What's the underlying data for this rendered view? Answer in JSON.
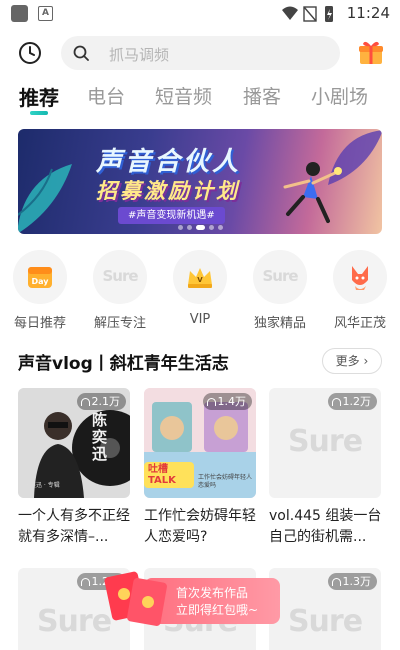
{
  "status_bar": {
    "time": "11:24",
    "app_icon_letter": "A"
  },
  "search": {
    "placeholder": "抓马调频"
  },
  "tabs": [
    {
      "label": "推荐",
      "active": true
    },
    {
      "label": "电台",
      "active": false
    },
    {
      "label": "短音频",
      "active": false
    },
    {
      "label": "播客",
      "active": false
    },
    {
      "label": "小剧场",
      "active": false
    }
  ],
  "banner": {
    "title_line1": "声音合伙人",
    "title_line2": "招募激励计划",
    "tagline": "#声音变现新机遇#",
    "slide_count": 5,
    "active_slide": 2
  },
  "quick_entries": [
    {
      "label": "每日推荐",
      "icon": "calendar-day-icon",
      "icon_text": "Day"
    },
    {
      "label": "解压专注",
      "icon": "sure-logo-icon",
      "icon_text": "Sure"
    },
    {
      "label": "VIP",
      "icon": "vip-crown-icon",
      "icon_text": "V"
    },
    {
      "label": "独家精品",
      "icon": "sure-logo-icon",
      "icon_text": "Sure"
    },
    {
      "label": "风华正茂",
      "icon": "fox-mascot-icon",
      "icon_text": ""
    }
  ],
  "section": {
    "title": "声音vlog丨斜杠青年生活志",
    "more_label": "更多"
  },
  "cards": [
    {
      "plays": "2.1万",
      "title": "一个人有多不正经就有多深情–...",
      "cover_text": "陈奕迅",
      "cover_sub": "唐奕迅 · 专辑"
    },
    {
      "plays": "1.4万",
      "title": "工作忙会妨碍年轻人恋爱吗?",
      "cover_text": "吐槽 TALK",
      "cover_sub": "工作忙会妨碍年轻人恋爱吗"
    },
    {
      "plays": "1.2万",
      "title": "vol.445 组装一台自己的街机需...",
      "cover_text": "Sure",
      "cover_sub": ""
    },
    {
      "plays": "1.2万",
      "title": "",
      "cover_text": "Sure",
      "cover_sub": ""
    },
    {
      "plays": "",
      "title": "",
      "cover_text": "Sure",
      "cover_sub": ""
    },
    {
      "plays": "1.3万",
      "title": "",
      "cover_text": "Sure",
      "cover_sub": ""
    }
  ],
  "promo": {
    "line1": "首次发布作品",
    "line2": "立即得红包哦~"
  },
  "colors": {
    "accent_teal": "#1fc4b9",
    "promo_pink": "#ff7f8e",
    "placeholder_gray": "#b5b5b5"
  }
}
